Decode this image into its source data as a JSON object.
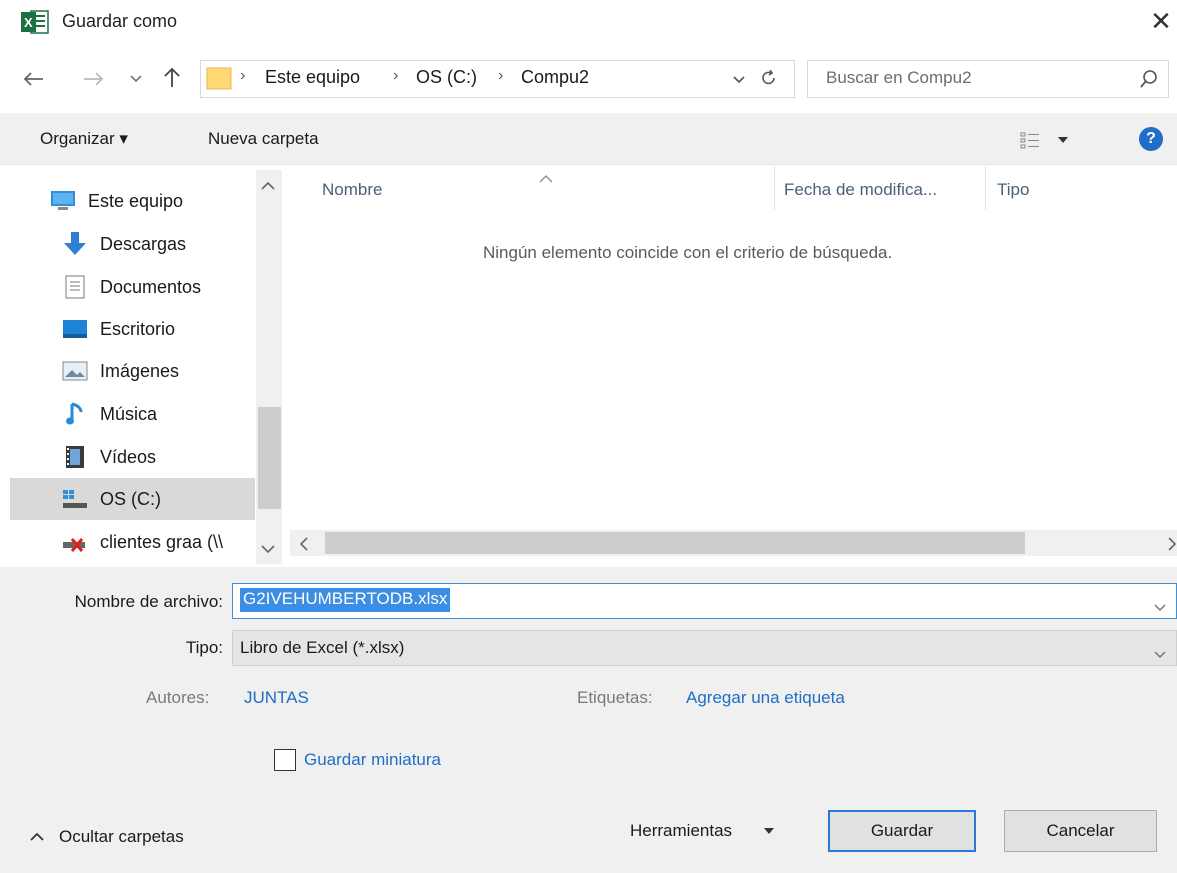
{
  "window": {
    "title": "Guardar como",
    "close_glyph": "✕"
  },
  "address": {
    "breadcrumbs": [
      "Este equipo",
      "OS (C:)",
      "Compu2"
    ],
    "separator": "›"
  },
  "search": {
    "placeholder": "Buscar en Compu2"
  },
  "toolbar": {
    "organize_label": "Organizar ▾",
    "new_folder_label": "Nueva carpeta",
    "help_glyph": "?"
  },
  "sidebar": {
    "items": [
      {
        "label": "Este equipo",
        "icon": "computer-icon"
      },
      {
        "label": "Descargas",
        "icon": "download-icon"
      },
      {
        "label": "Documentos",
        "icon": "documents-icon"
      },
      {
        "label": "Escritorio",
        "icon": "desktop-icon"
      },
      {
        "label": "Imágenes",
        "icon": "pictures-icon"
      },
      {
        "label": "Música",
        "icon": "music-icon"
      },
      {
        "label": "Vídeos",
        "icon": "videos-icon"
      },
      {
        "label": "OS (C:)",
        "icon": "drive-icon",
        "selected": true
      },
      {
        "label": "clientes graa (\\\\",
        "icon": "network-drive-disconnected-icon"
      }
    ]
  },
  "file_list": {
    "columns": [
      "Nombre",
      "Fecha de modifica...",
      "Tipo"
    ],
    "empty_message": "Ningún elemento coincide con el criterio de búsqueda."
  },
  "form": {
    "filename_label": "Nombre de archivo:",
    "filename_value": "G2IVEHUMBERTODB.xlsx",
    "type_label": "Tipo:",
    "type_value": "Libro de Excel (*.xlsx)",
    "authors_label": "Autores:",
    "authors_value": "JUNTAS",
    "tags_label": "Etiquetas:",
    "tags_value": "Agregar una etiqueta",
    "thumbnail_label": "Guardar miniatura",
    "thumbnail_checked": false
  },
  "footer": {
    "hide_folders_label": "Ocultar carpetas",
    "tools_label": "Herramientas",
    "save_label": "Guardar",
    "cancel_label": "Cancelar"
  },
  "colors": {
    "accent": "#2b79d6",
    "selection": "#3b8ee3",
    "link": "#1e6ec5",
    "excel_green": "#1d7044"
  }
}
